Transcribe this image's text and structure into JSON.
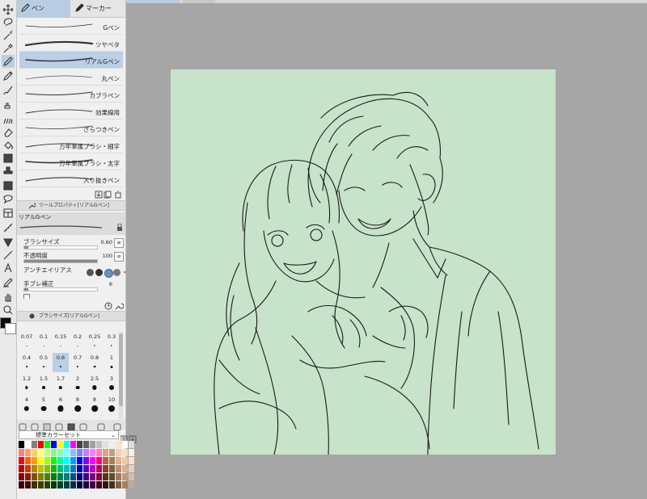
{
  "tabs": [
    {
      "label": "ペン"
    },
    {
      "label": "マーカー"
    }
  ],
  "brushes": [
    {
      "name": "Gペン"
    },
    {
      "name": "ツヤベタ"
    },
    {
      "name": "リアルGペン"
    },
    {
      "name": "丸ペン"
    },
    {
      "name": "カブラペン"
    },
    {
      "name": "効果線用"
    },
    {
      "name": "ざらつきペン"
    },
    {
      "name": "万年筆風ブラシ・細字"
    },
    {
      "name": "万年筆風ブラシ・太字"
    },
    {
      "name": "入り抜きペン"
    }
  ],
  "active_brush": "リアルGペン",
  "tool_property": {
    "header": "ツールプロパティ[リアルGペン]",
    "tool_name": "リアルGペン",
    "brush_size_label": "ブラシサイズ",
    "brush_size_value": "0.60",
    "opacity_label": "不透明度",
    "opacity_value": "100",
    "antialias_label": "アンチエイリアス",
    "stabilization_label": "手ブレ補正",
    "stabilization_value": "6"
  },
  "brush_size_panel": {
    "header": "ブラシサイズ[リアルGペン]",
    "sizes": [
      "0.07",
      "0.1",
      "0.15",
      "0.2",
      "0.25",
      "0.3",
      "0.4",
      "0.5",
      "0.6",
      "0.7",
      "0.8",
      "1",
      "1.2",
      "1.5",
      "1.7",
      "2",
      "2.5",
      "3",
      "4",
      "5",
      "6",
      "8",
      "8",
      "10"
    ],
    "selected": "0.6"
  },
  "color_set": {
    "name": "標準カラーセット"
  },
  "colors": {
    "canvas_bg": "#c7e3c9",
    "workspace": "#a6a6a6",
    "selection": "#b9d0e6",
    "line_art": "#1a1a1a"
  },
  "toolbar_icons": [
    "move-icon",
    "lasso-icon",
    "magic-wand-icon",
    "eyedropper-icon",
    "pen-icon",
    "pencil-icon",
    "brush-icon",
    "airbrush-icon",
    "decoration-icon",
    "eraser-icon",
    "fill-icon",
    "gradient-icon",
    "stamp-icon",
    "select-icon",
    "balloon-icon",
    "frame-icon",
    "ruler-icon",
    "figure-icon",
    "line-icon",
    "text-icon",
    "correction-icon",
    "hand-icon",
    "zoom-icon"
  ]
}
